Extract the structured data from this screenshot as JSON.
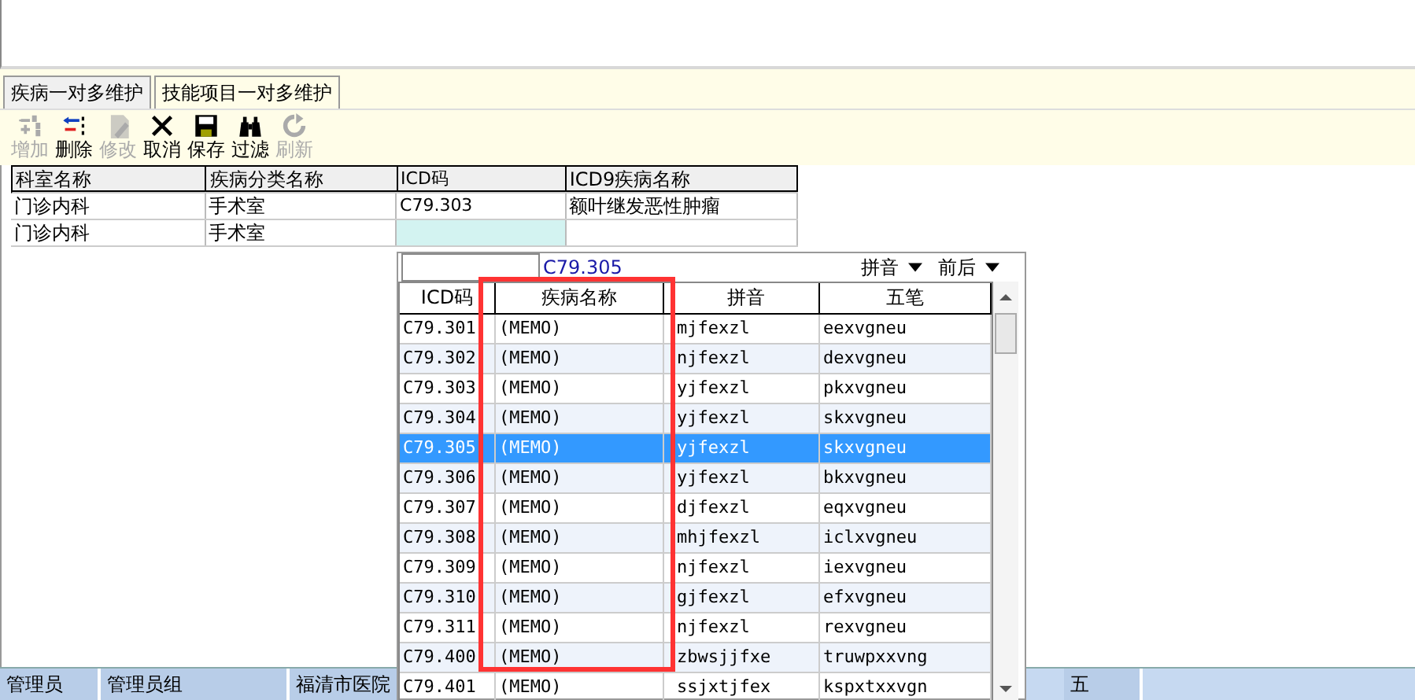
{
  "tabs": [
    {
      "label": "疾病一对多维护",
      "selected": true
    },
    {
      "label": "技能项目一对多维护",
      "selected": false
    }
  ],
  "toolbar": [
    {
      "kind": "add",
      "label": "增加",
      "disabled": true
    },
    {
      "kind": "delete",
      "label": "删除",
      "disabled": false
    },
    {
      "kind": "edit",
      "label": "修改",
      "disabled": true
    },
    {
      "kind": "cancel",
      "label": "取消",
      "disabled": false
    },
    {
      "kind": "save",
      "label": "保存",
      "disabled": false
    },
    {
      "kind": "filter",
      "label": "过滤",
      "disabled": false
    },
    {
      "kind": "refresh",
      "label": "刷新",
      "disabled": true
    }
  ],
  "grid": {
    "columns": [
      "科室名称",
      "疾病分类名称",
      "ICD码",
      "ICD9疾病名称"
    ],
    "rows": [
      {
        "cells": [
          "门诊内科",
          "手术室",
          "C79.303",
          "额叶继发恶性肿瘤"
        ],
        "editing": false
      },
      {
        "cells": [
          "门诊内科",
          "手术室",
          "",
          ""
        ],
        "editing": true
      }
    ]
  },
  "lookup": {
    "current_code": "C79.305",
    "buttons": [
      "拼音",
      "前后"
    ],
    "columns": [
      "ICD码",
      "疾病名称",
      "拼音",
      "五笔"
    ],
    "rows": [
      {
        "cells": [
          "C79.301",
          "(MEMO)",
          "mjfexzl",
          "eexvgneu"
        ],
        "selected": false
      },
      {
        "cells": [
          "C79.302",
          "(MEMO)",
          "njfexzl",
          "dexvgneu"
        ],
        "selected": false
      },
      {
        "cells": [
          "C79.303",
          "(MEMO)",
          "yjfexzl",
          "pkxvgneu"
        ],
        "selected": false
      },
      {
        "cells": [
          "C79.304",
          "(MEMO)",
          "yjfexzl",
          "skxvgneu"
        ],
        "selected": false
      },
      {
        "cells": [
          "C79.305",
          "(MEMO)",
          "yjfexzl",
          "skxvgneu"
        ],
        "selected": true
      },
      {
        "cells": [
          "C79.306",
          "(MEMO)",
          "yjfexzl",
          "bkxvgneu"
        ],
        "selected": false
      },
      {
        "cells": [
          "C79.307",
          "(MEMO)",
          "djfexzl",
          "eqxvgneu"
        ],
        "selected": false
      },
      {
        "cells": [
          "C79.308",
          "(MEMO)",
          "mhjfexzl",
          "iclxvgneu"
        ],
        "selected": false
      },
      {
        "cells": [
          "C79.309",
          "(MEMO)",
          "njfexzl",
          "iexvgneu"
        ],
        "selected": false
      },
      {
        "cells": [
          "C79.310",
          "(MEMO)",
          "gjfexzl",
          "efxvgneu"
        ],
        "selected": false
      },
      {
        "cells": [
          "C79.311",
          "(MEMO)",
          "njfexzl",
          "rexvgneu"
        ],
        "selected": false
      },
      {
        "cells": [
          "C79.400",
          "(MEMO)",
          "zbwsjjfxe",
          "truwpxxvng"
        ],
        "selected": false
      },
      {
        "cells": [
          "C79.401",
          "(MEMO)",
          "ssjxtjfex",
          "kspxtxxvgn"
        ],
        "selected": false
      }
    ]
  },
  "status_bar": [
    "管理员",
    "管理员组",
    "福清市医院",
    "五"
  ]
}
